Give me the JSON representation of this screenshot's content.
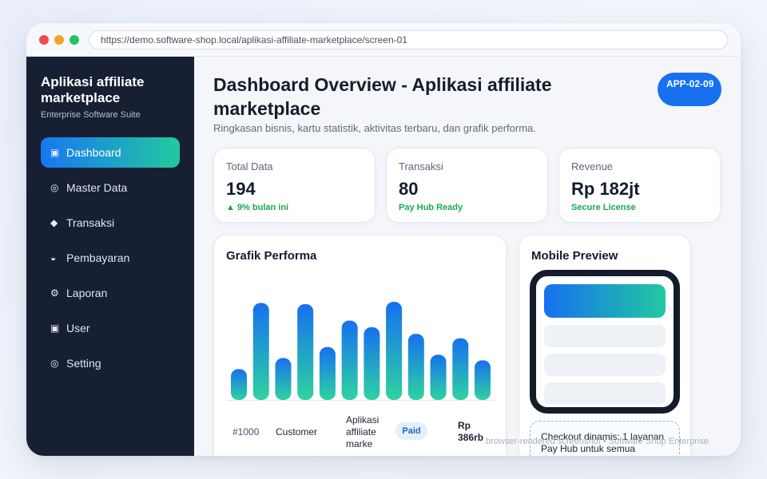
{
  "browser": {
    "url": "https://demo.software-shop.local/aplikasi-affiliate-marketplace/screen-01"
  },
  "sidebar": {
    "brand_title": "Aplikasi affiliate marketplace",
    "brand_subtitle": "Enterprise Software Suite",
    "items": [
      {
        "icon": "▣",
        "label": "Dashboard",
        "active": true
      },
      {
        "icon": "◎",
        "label": "Master Data"
      },
      {
        "icon": "◆",
        "label": "Transaksi"
      },
      {
        "icon": "◒",
        "label": "Pembayaran"
      },
      {
        "icon": "⚙",
        "label": "Laporan"
      },
      {
        "icon": "▣",
        "label": "User"
      },
      {
        "icon": "◎",
        "label": "Setting"
      }
    ]
  },
  "header": {
    "title": "Dashboard Overview - Aplikasi affiliate marketplace",
    "subtitle": "Ringkasan bisnis, kartu statistik, aktivitas terbaru, dan grafik performa.",
    "badge": "APP-02-09"
  },
  "stats": [
    {
      "label": "Total Data",
      "value": "194",
      "note": "▲ 9% bulan ini"
    },
    {
      "label": "Transaksi",
      "value": "80",
      "note": "Pay Hub Ready"
    },
    {
      "label": "Revenue",
      "value": "Rp 182jt",
      "note": "Secure License"
    }
  ],
  "chart_card": {
    "title": "Grafik Performa"
  },
  "chart_data": {
    "type": "bar",
    "values": [
      28,
      88,
      38,
      87,
      48,
      72,
      66,
      89,
      60,
      41,
      56,
      36
    ],
    "ylim": [
      0,
      100
    ],
    "colors": {
      "top": "#1670f0",
      "bottom": "#2fd3a0"
    }
  },
  "table_row": {
    "id": "#1000",
    "customer": "Customer",
    "product": "Aplikasi affiliate marke",
    "status": "Paid",
    "amount": "Rp 386rb"
  },
  "mobile_card": {
    "title": "Mobile Preview",
    "checkout_text": "Checkout dinamis: 1 layanan Pay Hub untuk semua"
  },
  "watermark": "browser-rendered screenshot • Software Shop Enterprise"
}
